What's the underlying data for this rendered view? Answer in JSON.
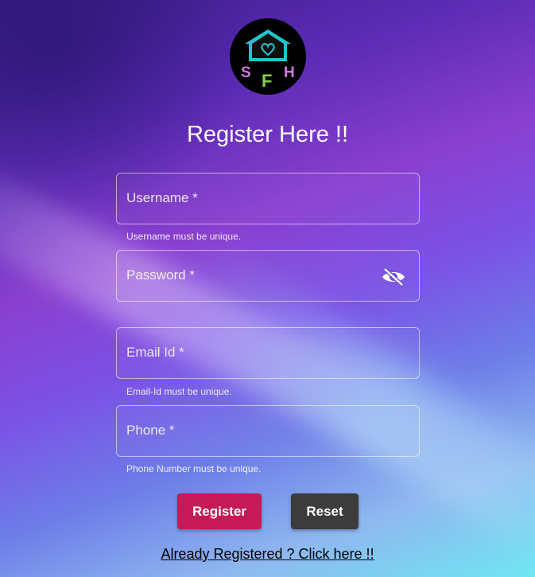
{
  "logo": {
    "letters": [
      "S",
      "F",
      "H"
    ],
    "letter_colors": [
      "#d07ae0",
      "#7fd44a",
      "#d07ae0"
    ],
    "house_color": "#1fc6cf"
  },
  "title": "Register Here !!",
  "form": {
    "username": {
      "label": "Username *",
      "helper": "Username must be unique."
    },
    "password": {
      "label": "Password *"
    },
    "email": {
      "label": "Email Id *",
      "helper": "Email-Id must be unique."
    },
    "phone": {
      "label": "Phone *",
      "helper": "Phone Number must be unique."
    }
  },
  "buttons": {
    "register": "Register",
    "reset": "Reset"
  },
  "login_link": "Already Registered ? Click here !!",
  "colors": {
    "register_button": "#c51a56",
    "reset_button": "#3c3c3c"
  }
}
